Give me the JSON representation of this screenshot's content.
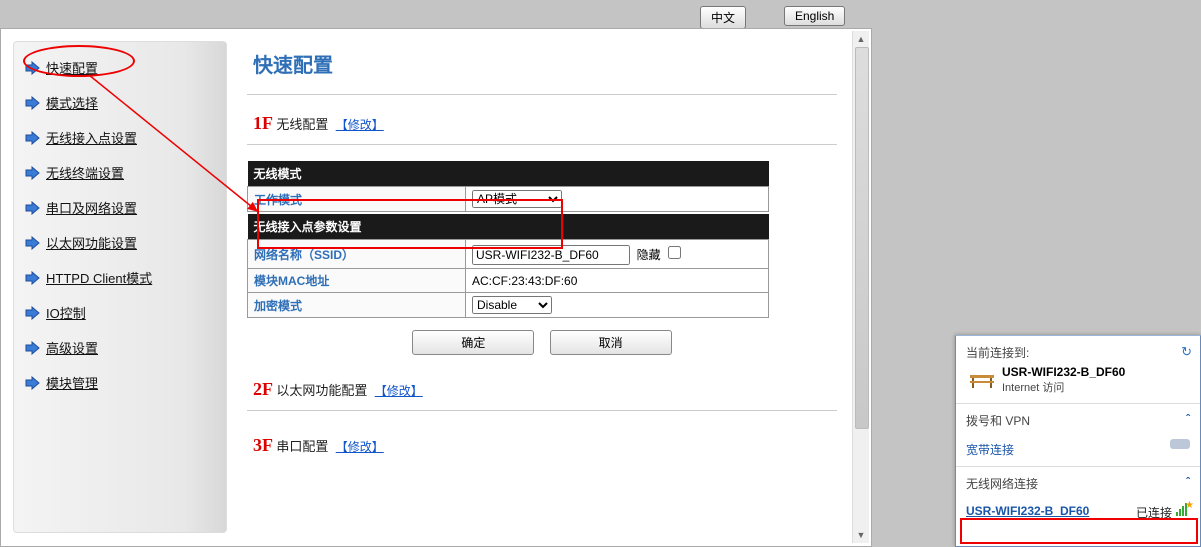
{
  "lang": {
    "cn": "中文",
    "en": "English"
  },
  "sidebar": {
    "items": [
      {
        "label": "快速配置"
      },
      {
        "label": "模式选择"
      },
      {
        "label": "无线接入点设置"
      },
      {
        "label": "无线终端设置"
      },
      {
        "label": "串口及网络设置"
      },
      {
        "label": "以太网功能设置"
      },
      {
        "label": "HTTPD Client模式"
      },
      {
        "label": "IO控制"
      },
      {
        "label": "高级设置"
      },
      {
        "label": "模块管理"
      }
    ]
  },
  "page": {
    "title": "快速配置",
    "steps": {
      "s1": {
        "num": "1F",
        "label": "无线配置",
        "modify": "【修改】"
      },
      "s2": {
        "num": "2F",
        "label": "以太网功能配置",
        "modify": "【修改】"
      },
      "s3": {
        "num": "3F",
        "label": "串口配置",
        "modify": "【修改】"
      }
    },
    "wireless_mode_header": "无线模式",
    "work_mode_label": "工作模式",
    "work_mode_value": "AP模式",
    "ap_params_header": "无线接入点参数设置",
    "ssid_label": "网络名称（SSID）",
    "ssid_value": "USR-WIFI232-B_DF60",
    "ssid_hide_label": "隐藏",
    "mac_label": "模块MAC地址",
    "mac_value": "AC:CF:23:43:DF:60",
    "enc_label": "加密模式",
    "enc_value": "Disable",
    "btn_ok": "确定",
    "btn_cancel": "取消"
  },
  "netpop": {
    "title": "当前连接到:",
    "conn_name": "USR-WIFI232-B_DF60",
    "conn_sub": "Internet 访问",
    "dial_vpn": "拨号和 VPN",
    "broadband": "宽带连接",
    "wlan_header": "无线网络连接",
    "wifi_ssid": "USR-WIFI232-B_DF60",
    "wifi_status": "已连接"
  }
}
